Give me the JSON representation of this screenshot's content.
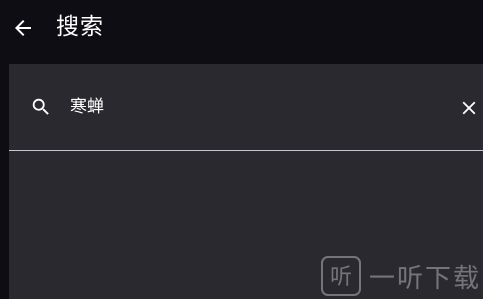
{
  "header": {
    "title": "搜索",
    "back_icon": "arrow-left-icon"
  },
  "search": {
    "value": "寒蝉",
    "search_icon": "search-icon",
    "clear_icon": "close-icon"
  },
  "watermark": {
    "logo_char": "听",
    "text": "一听下载"
  },
  "colors": {
    "background": "#0f0d14",
    "panel": "#2b2930",
    "divider": "#c9c5d0",
    "text": "#ffffff"
  }
}
